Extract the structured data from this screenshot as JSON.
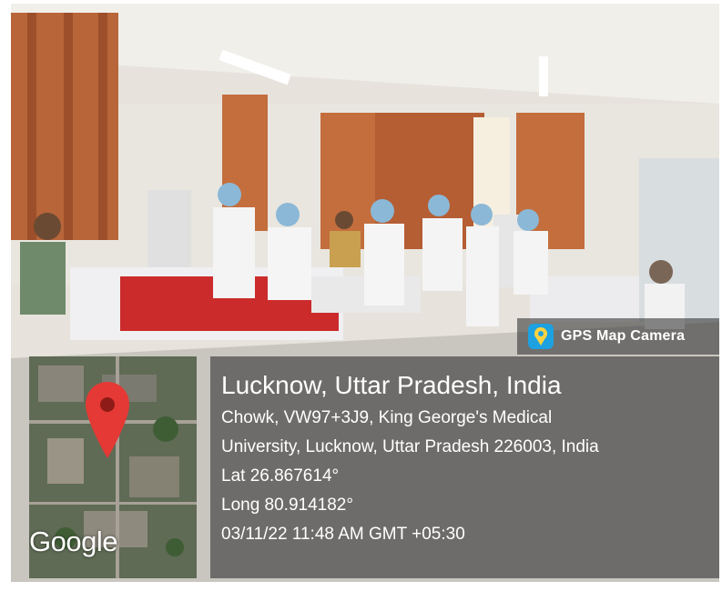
{
  "badge": {
    "icon": "map-pin-camera-icon",
    "label": "GPS Map Camera"
  },
  "map": {
    "icon": "location-pin-icon",
    "brand": "Google"
  },
  "location": {
    "title": "Lucknow, Uttar Pradesh, India",
    "address_line1": "Chowk, VW97+3J9, King George's Medical",
    "address_line2": "University, Lucknow, Uttar Pradesh 226003, India",
    "lat": "Lat 26.867614°",
    "long": "Long 80.914182°",
    "datetime": "03/11/22 11:48 AM GMT +05:30"
  },
  "colors": {
    "badge_icon": "#1da1e0",
    "pin": "#e53935",
    "curtain": "#b8653a"
  }
}
